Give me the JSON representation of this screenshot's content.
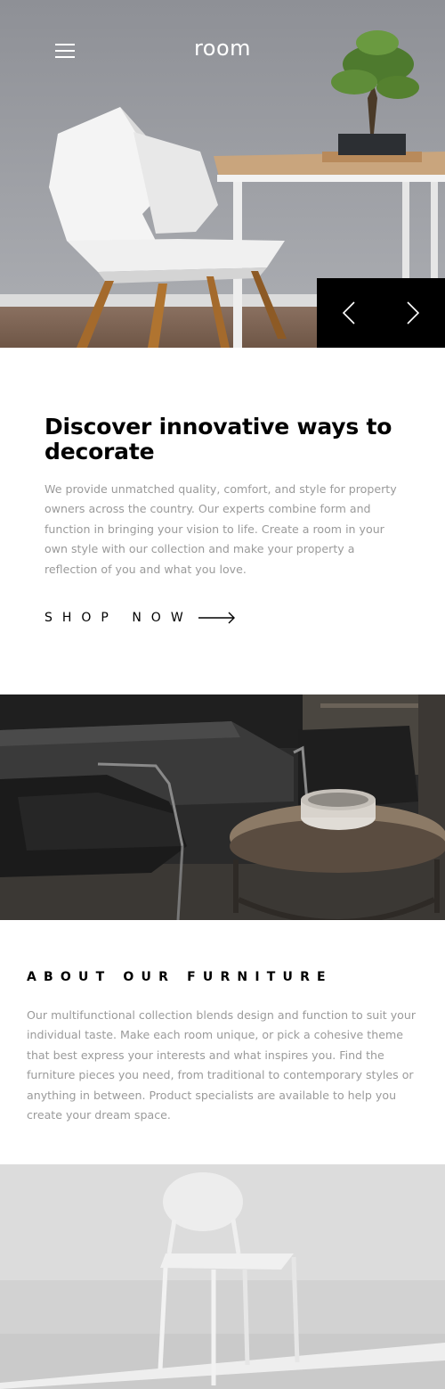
{
  "header": {
    "logo": "room",
    "menu_icon": "hamburger-menu-icon"
  },
  "hero": {
    "image": "white-chair-and-table-with-bonsai",
    "prev_icon": "chevron-left-icon",
    "next_icon": "chevron-right-icon"
  },
  "discover": {
    "title": "Discover innovative ways to decorate",
    "body": "We provide unmatched quality, comfort, and style for property owners across the country. Our experts combine form and function in bringing your vision to life. Create a room in your own style with our collection and make your property a reflection of you and what you love.",
    "cta_label": "SHOP NOW",
    "cta_icon": "arrow-right-icon"
  },
  "dark_image": {
    "image": "dark-armchair-and-coffee-table"
  },
  "about": {
    "title": "ABOUT OUR FURNITURE",
    "body": "Our multifunctional collection blends design and function to suit your individual taste. Make each room unique, or pick a cohesive theme that best express your interests and what inspires you. Find the furniture pieces you need, from traditional to contemporary styles or anything in between. Product specialists are available to help you create your dream space."
  },
  "light_image": {
    "image": "white-chair-light-background"
  },
  "colors": {
    "text": "#000000",
    "muted": "#9a9a9a",
    "background": "#ffffff",
    "controls_bg": "#000000"
  }
}
